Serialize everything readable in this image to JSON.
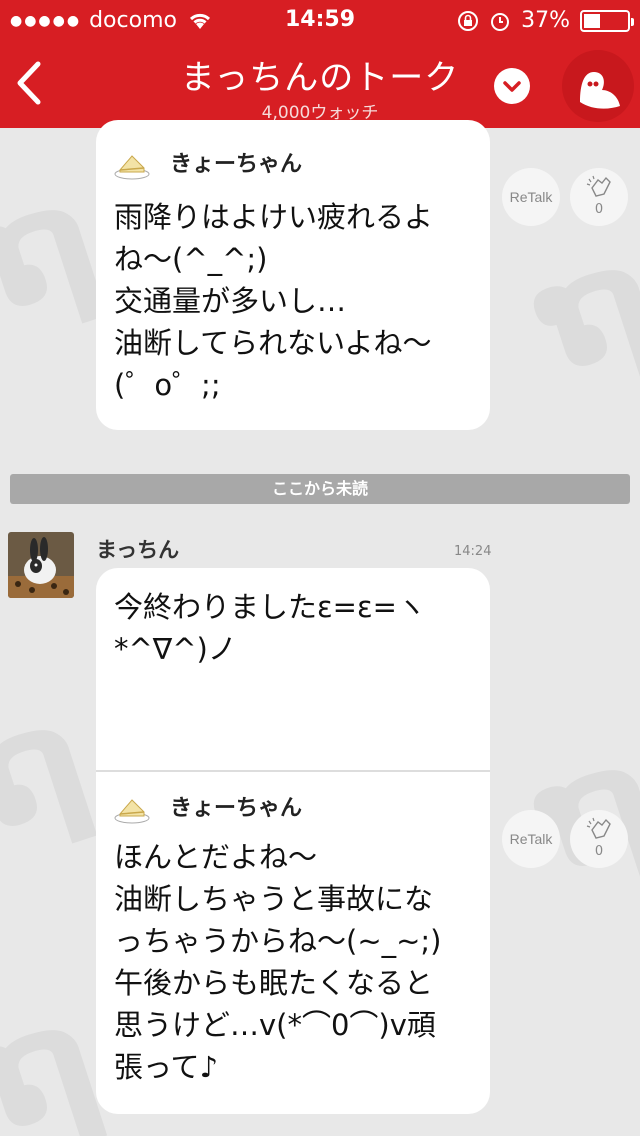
{
  "status_bar": {
    "carrier": "docomo",
    "time": "14:59",
    "battery": "37%",
    "battery_fraction": 0.37
  },
  "header": {
    "title": "まっちんのトーク",
    "watchers": "4,000ウォッチ"
  },
  "messages": [
    {
      "quoted_name": "きょーちゃん",
      "text": "雨降りはよけい疲れるよ\nね〜(^_^;)\n交通量が多いし…\n油断してられないよね〜\n(゜o゜;;",
      "retalk_label": "ReTalk",
      "claps": "0"
    }
  ],
  "unread_divider": "ここから未読",
  "post": {
    "sender": "まっちん",
    "time": "14:24",
    "text": "今終わりましたε=ε=ヽ\n*^∇^)ノ",
    "quote": {
      "quoted_name": "きょーちゃん",
      "text": "ほんとだよね〜\n油断しちゃうと事故にな\nっちゃうからね〜(~_~;)\n午後からも眠たくなると\n思うけど…v(*⌒0⌒)v頑\n張って♪",
      "retalk_label": "ReTalk",
      "claps": "0"
    }
  },
  "colors": {
    "header": "#d71e23",
    "background": "#e8e8e8",
    "bubble": "#ffffff",
    "divider": "#a8a8a8"
  }
}
